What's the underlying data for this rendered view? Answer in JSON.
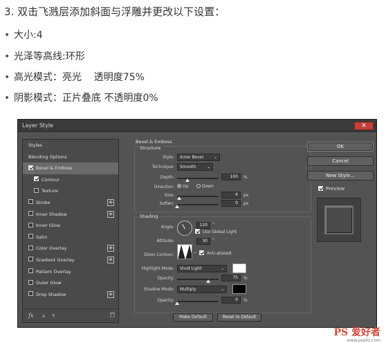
{
  "instructions": {
    "title": "3. 双击飞溅层添加斜面与浮雕并更改以下设置：",
    "bullets": [
      "大小:4",
      "光泽等高线:环形",
      "高光模式：亮光    透明度75%",
      "阴影模式：正片叠底 不透明度0%"
    ]
  },
  "dialog": {
    "title": "Layer Style",
    "close": "✕",
    "left_items": [
      {
        "label": "Styles",
        "checkbox": false,
        "checked": false,
        "plus": false,
        "selected": false,
        "indent": false
      },
      {
        "label": "Blending Options",
        "checkbox": false,
        "checked": false,
        "plus": false,
        "selected": false,
        "indent": false
      },
      {
        "label": "Bevel & Emboss",
        "checkbox": true,
        "checked": true,
        "plus": false,
        "selected": true,
        "indent": false
      },
      {
        "label": "Contour",
        "checkbox": true,
        "checked": true,
        "plus": false,
        "selected": false,
        "indent": true
      },
      {
        "label": "Texture",
        "checkbox": true,
        "checked": false,
        "plus": false,
        "selected": false,
        "indent": true
      },
      {
        "label": "Stroke",
        "checkbox": true,
        "checked": false,
        "plus": true,
        "selected": false,
        "indent": false
      },
      {
        "label": "Inner Shadow",
        "checkbox": true,
        "checked": false,
        "plus": true,
        "selected": false,
        "indent": false
      },
      {
        "label": "Inner Glow",
        "checkbox": true,
        "checked": false,
        "plus": false,
        "selected": false,
        "indent": false
      },
      {
        "label": "Satin",
        "checkbox": true,
        "checked": false,
        "plus": false,
        "selected": false,
        "indent": false
      },
      {
        "label": "Color Overlay",
        "checkbox": true,
        "checked": false,
        "plus": true,
        "selected": false,
        "indent": false
      },
      {
        "label": "Gradient Overlay",
        "checkbox": true,
        "checked": false,
        "plus": true,
        "selected": false,
        "indent": false
      },
      {
        "label": "Pattern Overlay",
        "checkbox": true,
        "checked": false,
        "plus": false,
        "selected": false,
        "indent": false
      },
      {
        "label": "Outer Glow",
        "checkbox": true,
        "checked": false,
        "plus": false,
        "selected": false,
        "indent": false
      },
      {
        "label": "Drop Shadow",
        "checkbox": true,
        "checked": false,
        "plus": true,
        "selected": false,
        "indent": false
      }
    ],
    "footer": {
      "fx": "fx",
      "up": "▲",
      "down": "▼",
      "trash": "🗑"
    },
    "bevel": {
      "heading": "Bevel & Emboss",
      "structure": "Structure",
      "style_label": "Style:",
      "style_value": "Inner Bevel",
      "technique_label": "Technique:",
      "technique_value": "Smooth",
      "depth_label": "Depth:",
      "depth_value": "100",
      "depth_unit": "%",
      "depth_level": 0.25,
      "direction_label": "Direction:",
      "dir_up": "Up",
      "dir_down": "Down",
      "size_label": "Size:",
      "size_value": "4",
      "size_unit": "px",
      "size_level": 0.05,
      "soften_label": "Soften:",
      "soften_value": "0",
      "soften_unit": "px",
      "soften_level": 0.0
    },
    "shading": {
      "heading": "Shading",
      "angle_label": "Angle:",
      "angle_value": "120",
      "angle_unit": "°",
      "global_light": "Use Global Light",
      "altitude_label": "Altitude:",
      "altitude_value": "30",
      "altitude_unit": "°",
      "gloss_label": "Gloss Contour:",
      "anti_aliased": "Anti-aliased",
      "highlight_label": "Highlight Mode:",
      "highlight_value": "Vivid Light",
      "highlight_color": "#ffffff",
      "hi_opacity_label": "Opacity:",
      "hi_opacity_value": "75",
      "hi_opacity_unit": "%",
      "hi_opacity_level": 0.75,
      "shadow_label": "Shadow Mode:",
      "shadow_value": "Multiply",
      "shadow_color": "#000000",
      "sh_opacity_label": "Opacity:",
      "sh_opacity_value": "0",
      "sh_opacity_unit": "%",
      "sh_opacity_level": 0.0
    },
    "make_default": "Make Default",
    "reset_default": "Reset to Default",
    "ok": "OK",
    "cancel": "Cancel",
    "new_style": "New Style...",
    "preview": "Preview"
  },
  "watermark": {
    "logo": "PS 爱好者",
    "site": "www.psahz.com"
  }
}
